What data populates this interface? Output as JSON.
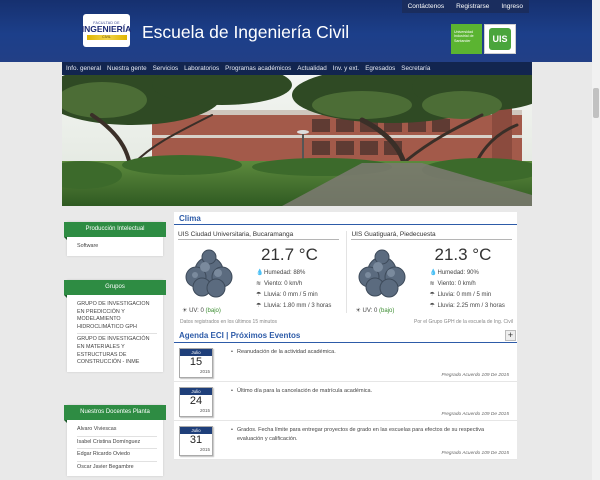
{
  "header": {
    "top_links": [
      "Contáctenos",
      "Registrarse",
      "Ingreso"
    ],
    "logo_text_small": "FACULTAD DE",
    "logo_text": "INGENIERÍA",
    "logo_text_bar": "CIVIL",
    "site_title": "Escuela de Ingeniería Civil",
    "uis_box_text": "Universidad Industrial de Santander",
    "uis_logo_text": "UIS"
  },
  "nav": {
    "items": [
      "Info. general",
      "Nuestra gente",
      "Servicios",
      "Laboratorios",
      "Programas académicos",
      "Actualidad",
      "Inv. y ext.",
      "Egresados",
      "Secretaría"
    ]
  },
  "sidebar": {
    "produccion": {
      "title": "Producción Intelectual",
      "items": [
        "Software"
      ]
    },
    "grupos": {
      "title": "Grupos",
      "items": [
        "GRUPO DE INVESTIGACION EN PREDICCIÓN Y MODELAMIENTO HIDROCLIMÁTICO GPH",
        "GRUPO DE INVESTIGACIÓN EN MATERIALES Y ESTRUCTURAS DE CONSTRUCCIÓN - INME"
      ]
    },
    "docentes": {
      "title": "Nuestros Docentes Planta",
      "items": [
        "Alvaro Viviescas",
        "Isabel Cristina Domínguez",
        "Edgar Ricardo Oviedo",
        "Oscar Javier Begambre"
      ]
    }
  },
  "clima": {
    "title": "Clima",
    "stations": [
      {
        "name": "UIS Ciudad Universitaria, Bucaramanga",
        "temp": "21.7 °C",
        "humidity": "Humedad: 88%",
        "wind": "Viento: 0 km/h",
        "rain5": "Lluvia: 0 mm / 5 min",
        "rain3h": "Lluvia: 1.80 mm / 3 horas",
        "uv_label": "UV: 0",
        "uv_level": "(bajo)"
      },
      {
        "name": "UIS Guatiguará, Piedecuesta",
        "temp": "21.3 °C",
        "humidity": "Humedad: 90%",
        "wind": "Viento: 0 km/h",
        "rain5": "Lluvia: 0 mm / 5 min",
        "rain3h": "Lluvia: 2.25 mm / 3 horas",
        "uv_label": "UV: 0",
        "uv_level": "(bajo)"
      }
    ],
    "footer_left": "Datos registrados en los últimos 15 minutos",
    "footer_right": "Por el Grupo GPH de la escuela de Ing. Civil"
  },
  "agenda": {
    "title": "Agenda ECI | Próximos Eventos",
    "plus_label": "+",
    "events": [
      {
        "month": "Julio",
        "day": "15",
        "year": "2015",
        "text": "Reanudación de la actividad académica.",
        "source": "Pregrado Acuerdo 109 De 2015"
      },
      {
        "month": "Julio",
        "day": "24",
        "year": "2015",
        "text": "Último día para la cancelación de matrícula académica.",
        "source": "Pregrado Acuerdo 109 De 2015"
      },
      {
        "month": "Julio",
        "day": "31",
        "year": "2015",
        "text": "Grados. Fecha límite para entregar proyectos de grado en las escuelas para efectos de su respectiva evaluación y calificación.",
        "source": "Pregrado Acuerdo 109 De 2015"
      }
    ]
  }
}
